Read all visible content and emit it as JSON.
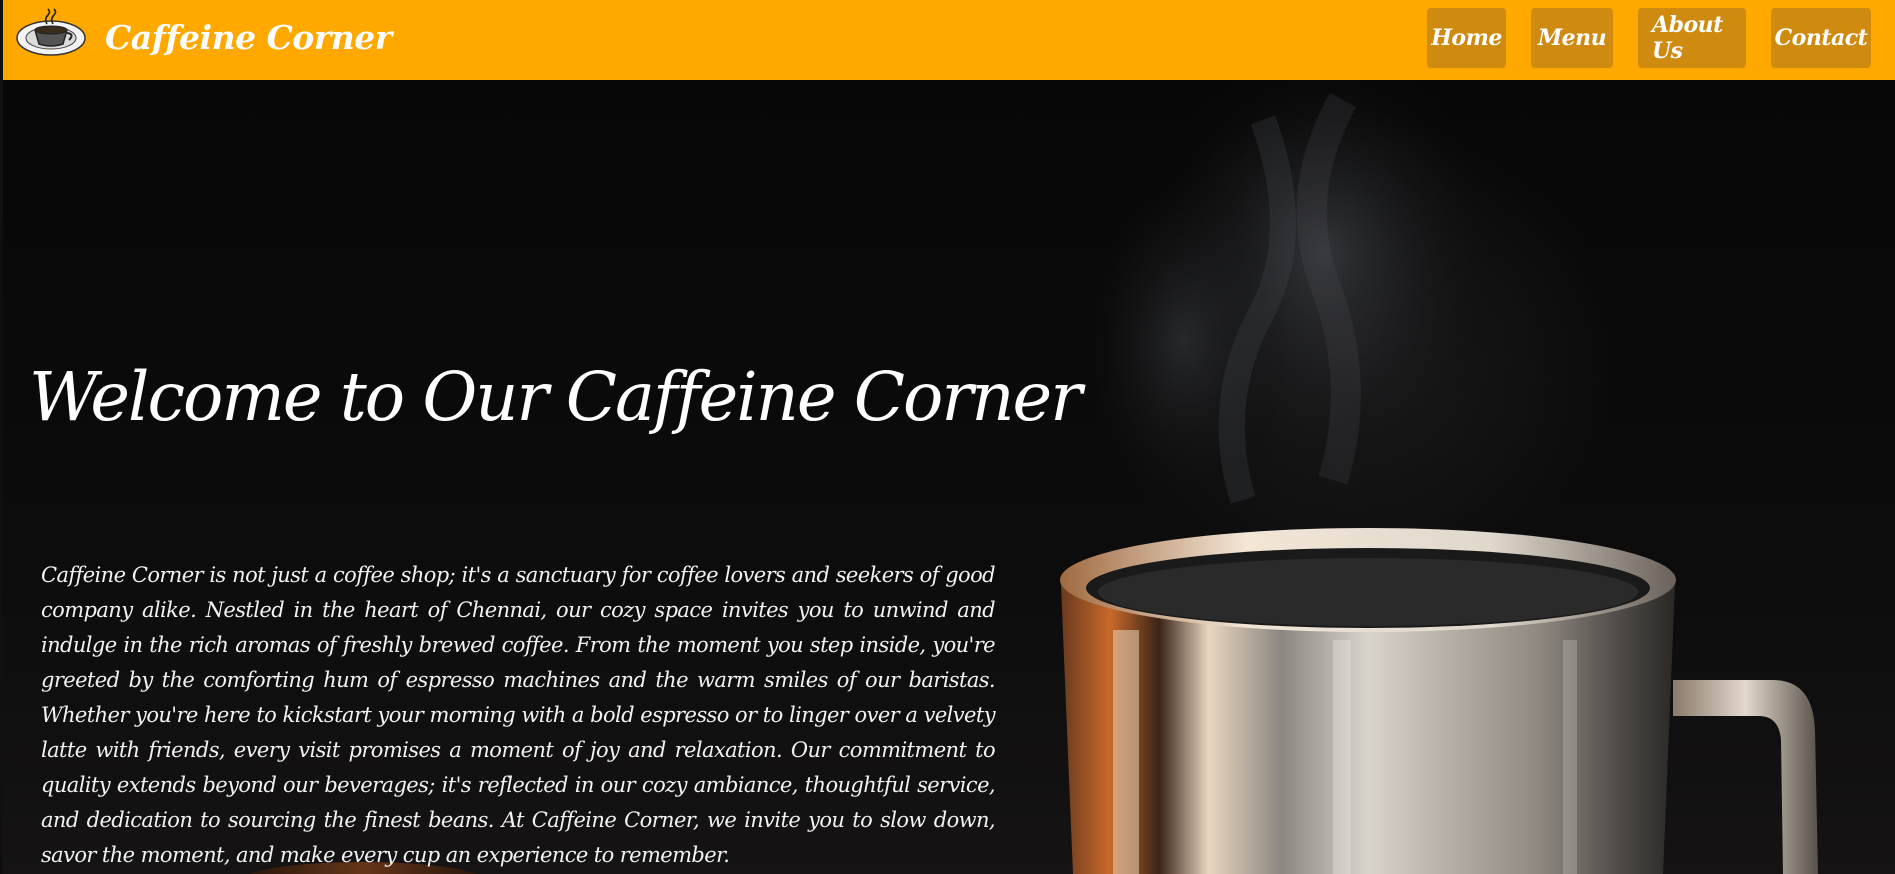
{
  "header": {
    "brand": "Caffeine Corner",
    "logo_icon": "coffee-cup-logo-icon"
  },
  "nav": {
    "items": [
      {
        "label": "Home"
      },
      {
        "label": "Menu"
      },
      {
        "label": "About Us"
      },
      {
        "label": "Contact"
      }
    ]
  },
  "hero": {
    "title": "Welcome to Our Caffeine Corner",
    "paragraph": "Caffeine Corner is not just a coffee shop; it's a sanctuary for coffee lovers and seekers of good company alike. Nestled in the heart of Chennai, our cozy space invites you to unwind and indulge in the rich aromas of freshly brewed coffee. From the moment you step inside, you're greeted by the comforting hum of espresso machines and the warm smiles of our baristas. Whether you're here to kickstart your morning with a bold espresso or to linger over a velvety latte with friends, every visit promises a moment of joy and relaxation. Our commitment to quality extends beyond our beverages; it's reflected in our cozy ambiance, thoughtful service, and dedication to sourcing the finest beans. At Caffeine Corner, we invite you to slow down, savor the moment, and make every cup an experience to remember.",
    "image_icon": "steaming-steel-coffee-cup-image"
  },
  "colors": {
    "navbar": "#ffa800",
    "nav_button": "#cf8a10",
    "hero_background": "#0a0a0a",
    "text": "#ffffff"
  }
}
